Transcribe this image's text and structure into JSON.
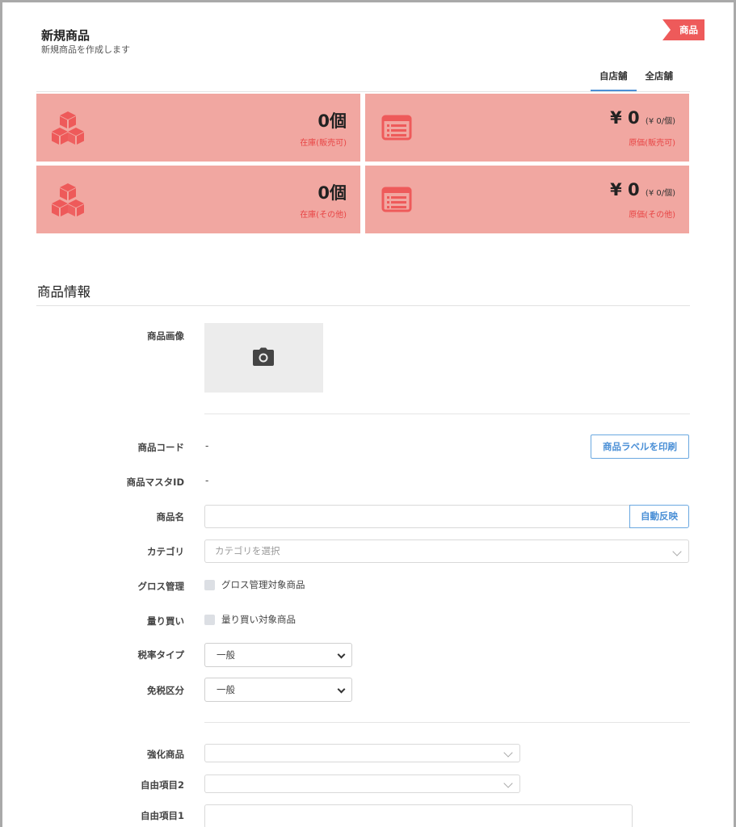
{
  "header": {
    "title": "新規商品",
    "subtitle": "新規商品を作成します",
    "ribbon_label": "商品"
  },
  "tabs": [
    {
      "label": "自店舗",
      "active": true
    },
    {
      "label": "全店舗",
      "active": false
    }
  ],
  "stats": {
    "stock_sale": {
      "value": "0個",
      "caption": "在庫(販売可)"
    },
    "cost_sale": {
      "value": "¥ 0",
      "unit": "(¥ 0/個)",
      "caption": "原価(販売可)"
    },
    "stock_other": {
      "value": "0個",
      "caption": "在庫(その他)"
    },
    "cost_other": {
      "value": "¥ 0",
      "unit": "(¥ 0/個)",
      "caption": "原価(その他)"
    }
  },
  "colors": {
    "card_bg": "#f1a7a1",
    "card_icon": "#ee5a5a",
    "accent": "#4a8fd6",
    "ribbon": "#ee5a5a"
  },
  "product_info": {
    "section_title": "商品情報",
    "image_label": "商品画像",
    "code_label": "商品コード",
    "code_value": "-",
    "print_label_button": "商品ラベルを印刷",
    "master_id_label": "商品マスタID",
    "master_id_value": "-",
    "name_label": "商品名",
    "name_value": "",
    "auto_reflect_button": "自動反映",
    "category_label": "カテゴリ",
    "category_placeholder": "カテゴリを選択",
    "gross_label": "グロス管理",
    "gross_checkbox_label": "グロス管理対象商品",
    "bulk_label": "量り買い",
    "bulk_checkbox_label": "量り買い対象商品",
    "tax_type_label": "税率タイプ",
    "tax_type_value": "一般",
    "tax_exempt_label": "免税区分",
    "tax_exempt_value": "一般",
    "enhanced_label": "強化商品",
    "enhanced_value": "",
    "free2_label": "自由項目2",
    "free2_value": "",
    "free1_label": "自由項目1",
    "free1_value": ""
  }
}
